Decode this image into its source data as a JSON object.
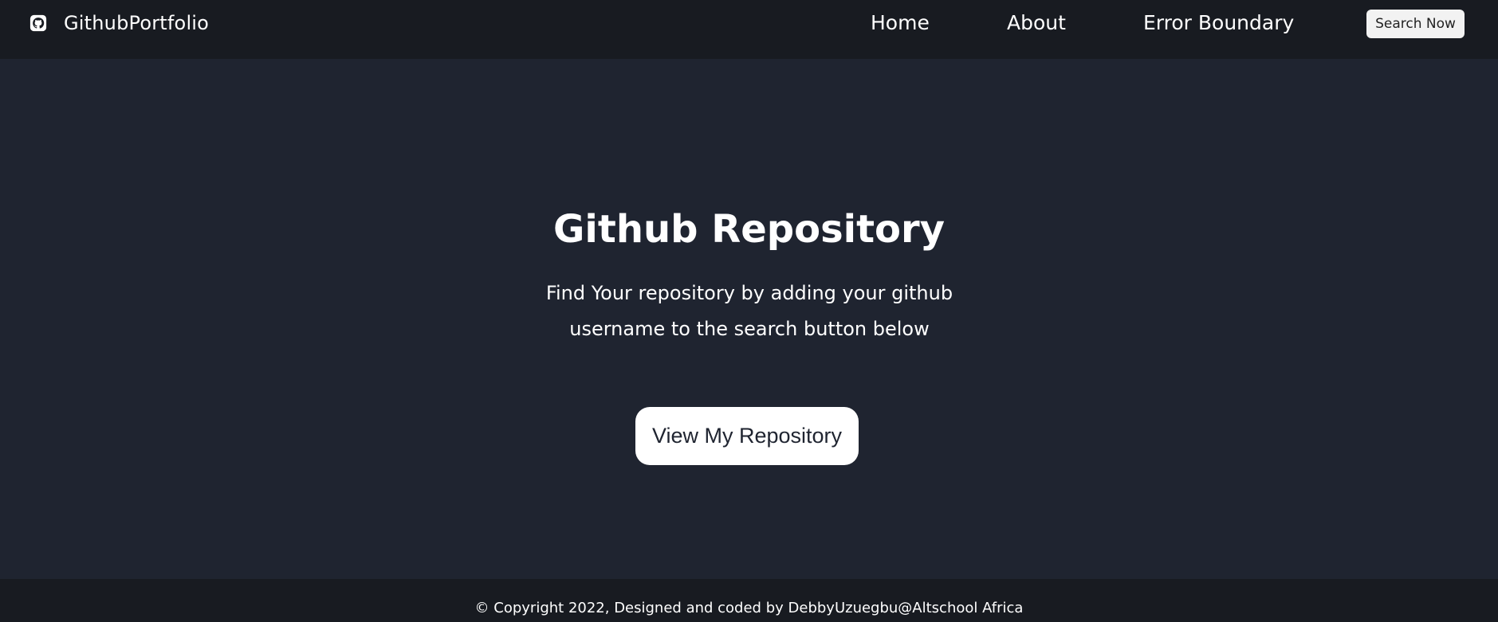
{
  "navbar": {
    "brand": {
      "icon": "github-icon",
      "text": "GithubPortfolio"
    },
    "links": [
      {
        "label": "Home"
      },
      {
        "label": "About"
      },
      {
        "label": "Error Boundary"
      }
    ],
    "search_button": "Search Now"
  },
  "hero": {
    "title": "Github Repository",
    "description": "Find Your repository by adding your github username to the search button below",
    "cta_button": "View My Repository"
  },
  "footer": {
    "text": "© Copyright 2022, Designed and coded by DebbyUzuegbu@Altschool Africa"
  },
  "colors": {
    "navbar_bg": "#181b21",
    "page_bg": "#1f2430",
    "text": "#ffffff",
    "button_bg": "#ffffff",
    "search_button_bg": "#f2f2f2"
  }
}
